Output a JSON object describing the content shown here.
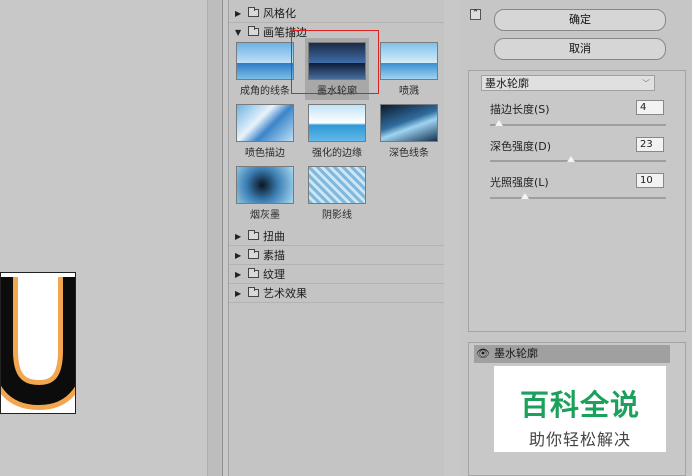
{
  "buttons": {
    "ok": "确定",
    "cancel": "取消"
  },
  "gallery": {
    "categories_top": [
      {
        "label": "风格化",
        "expanded": false
      },
      {
        "label": "画笔描边",
        "expanded": true
      }
    ],
    "thumbnails": [
      {
        "label": "成角的线条",
        "selected": false
      },
      {
        "label": "墨水轮廓",
        "selected": true
      },
      {
        "label": "喷溅",
        "selected": false
      },
      {
        "label": "喷色描边",
        "selected": false
      },
      {
        "label": "强化的边缘",
        "selected": false
      },
      {
        "label": "深色线条",
        "selected": false
      },
      {
        "label": "烟灰墨",
        "selected": false
      },
      {
        "label": "阴影线",
        "selected": false
      }
    ],
    "categories_bottom": [
      {
        "label": "扭曲",
        "expanded": false
      },
      {
        "label": "素描",
        "expanded": false
      },
      {
        "label": "纹理",
        "expanded": false
      },
      {
        "label": "艺术效果",
        "expanded": false
      }
    ]
  },
  "filter_select": {
    "value": "墨水轮廓"
  },
  "params": [
    {
      "label": "描边长度(S)",
      "value": "4",
      "level": 0.05
    },
    {
      "label": "深色强度(D)",
      "value": "23",
      "level": 0.46
    },
    {
      "label": "光照强度(L)",
      "value": "10",
      "level": 0.2
    }
  ],
  "layer": {
    "name": "墨水轮廓"
  },
  "watermark": {
    "main": "百科全说",
    "sub": "助你轻松解决"
  },
  "icons": {
    "collapse": "collapse-icon",
    "eye": "eye-icon",
    "folder": "folder-icon",
    "triangle": "disclosure-triangle-icon"
  }
}
